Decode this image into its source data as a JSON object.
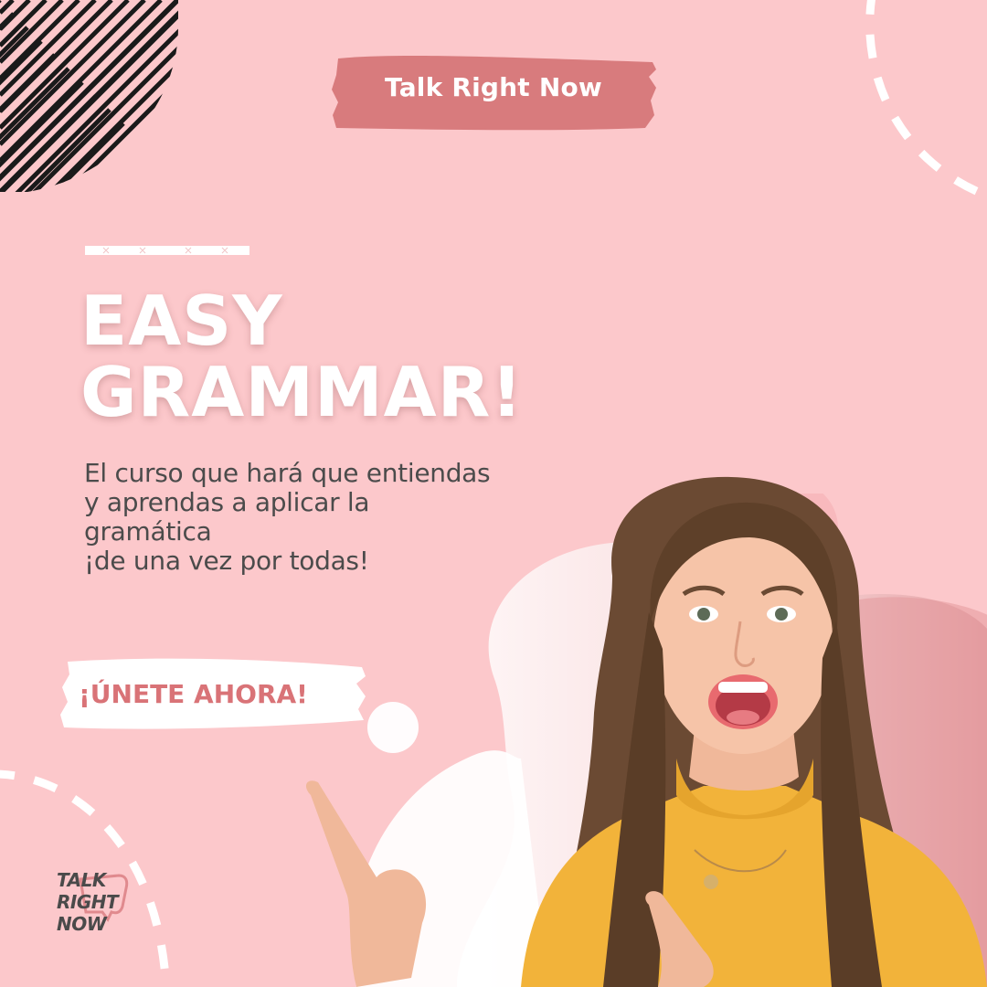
{
  "header": {
    "badge_text": "Talk Right Now"
  },
  "headline": {
    "line1": "EASY",
    "line2": "GRAMMAR!"
  },
  "subtitle": {
    "line1": "El curso que hará que entiendas",
    "line2": "y aprendas a aplicar la",
    "line3": "gramática",
    "line4": "¡de una vez por todas!"
  },
  "cta": {
    "label": "¡ÚNETE AHORA!"
  },
  "logo": {
    "line1": "TALK",
    "line2": "RIGHT",
    "line3": "NOW"
  },
  "icons": {
    "stripes": "diagonal-stripes-decoration",
    "arc": "dashed-arc-decoration",
    "person": "woman-pointing-illustration"
  },
  "colors": {
    "background": "#fcc8cb",
    "badge": "#d87b7d",
    "accent_text": "#d97377",
    "body_text": "#4b4b4b",
    "sweater": "#f2b33a",
    "hair": "#6b4a33"
  }
}
